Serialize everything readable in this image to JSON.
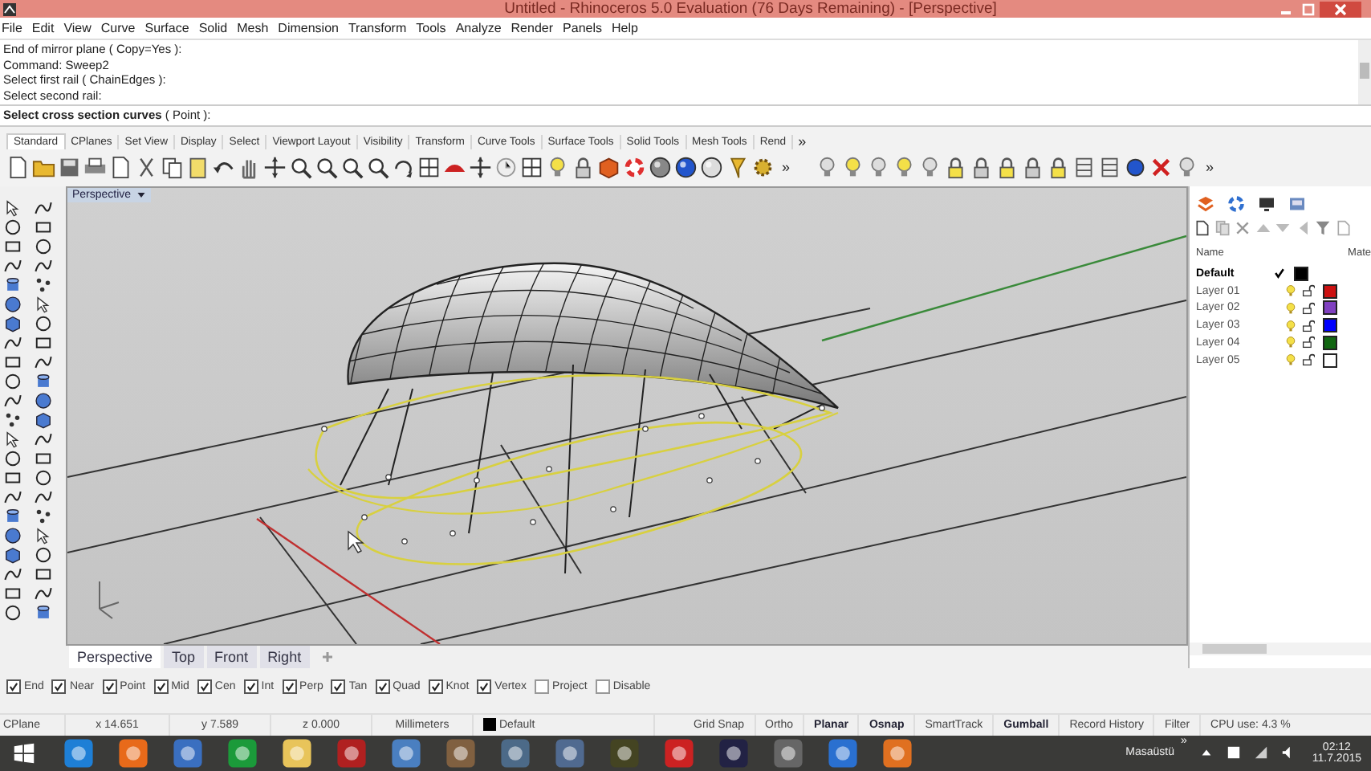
{
  "window": {
    "title": "Untitled - Rhinoceros 5.0 Evaluation (76 Days Remaining) - [Perspective]"
  },
  "menu": [
    "File",
    "Edit",
    "View",
    "Curve",
    "Surface",
    "Solid",
    "Mesh",
    "Dimension",
    "Transform",
    "Tools",
    "Analyze",
    "Render",
    "Panels",
    "Help"
  ],
  "command_history": [
    "End of mirror plane ( Copy=Yes ):",
    "Command: Sweep2",
    "Select first rail ( ChainEdges ):",
    "Select second rail:"
  ],
  "command_prompt": "**Select cross section curves** ( Point ):",
  "toolbar": {
    "tabs": [
      {
        "label": "Standard",
        "selected": true
      },
      {
        "label": "CPlanes",
        "selected": false
      },
      {
        "label": "Set View",
        "selected": false
      },
      {
        "label": "Display",
        "selected": false
      },
      {
        "label": "Select",
        "selected": false
      },
      {
        "label": "Viewport Layout",
        "selected": false
      },
      {
        "label": "Visibility",
        "selected": false
      },
      {
        "label": "Transform",
        "selected": false
      },
      {
        "label": "Curve Tools",
        "selected": false
      },
      {
        "label": "Surface Tools",
        "selected": false
      },
      {
        "label": "Solid Tools",
        "selected": false
      },
      {
        "label": "Mesh Tools",
        "selected": false
      },
      {
        "label": "Rend",
        "selected": false
      }
    ],
    "tabs_overflow": "»",
    "icons_overflow": "»",
    "right_overflow": "»"
  },
  "viewport": {
    "label": "Perspective"
  },
  "viewport_tabs": [
    {
      "label": "Perspective",
      "selected": true
    },
    {
      "label": "Top",
      "selected": false
    },
    {
      "label": "Front",
      "selected": false
    },
    {
      "label": "Right",
      "selected": false
    }
  ],
  "layers_panel": {
    "columns": [
      "Name",
      "Mate"
    ],
    "layers": [
      {
        "name": "Default",
        "current": true,
        "color": "#000000"
      },
      {
        "name": "Layer 01",
        "current": false,
        "color": "#cc1111"
      },
      {
        "name": "Layer 02",
        "current": false,
        "color": "#8040c0"
      },
      {
        "name": "Layer 03",
        "current": false,
        "color": "#0000ff"
      },
      {
        "name": "Layer 04",
        "current": false,
        "color": "#116611"
      },
      {
        "name": "Layer 05",
        "current": false,
        "color": "#ffffff"
      }
    ]
  },
  "osnaps": [
    {
      "label": "End",
      "checked": true
    },
    {
      "label": "Near",
      "checked": true
    },
    {
      "label": "Point",
      "checked": true
    },
    {
      "label": "Mid",
      "checked": true
    },
    {
      "label": "Cen",
      "checked": true
    },
    {
      "label": "Int",
      "checked": true
    },
    {
      "label": "Perp",
      "checked": true
    },
    {
      "label": "Tan",
      "checked": true
    },
    {
      "label": "Quad",
      "checked": true
    },
    {
      "label": "Knot",
      "checked": true
    },
    {
      "label": "Vertex",
      "checked": true
    },
    {
      "label": "Project",
      "checked": false
    },
    {
      "label": "Disable",
      "checked": false
    }
  ],
  "status_bar": {
    "cplane": "CPlane",
    "x": "x 14.651",
    "y": "y 7.589",
    "z": "z 0.000",
    "units": "Millimeters",
    "layer": {
      "name": "Default",
      "color": "#000000"
    },
    "toggles": [
      {
        "label": "Grid Snap",
        "on": false
      },
      {
        "label": "Ortho",
        "on": false
      },
      {
        "label": "Planar",
        "on": true
      },
      {
        "label": "Osnap",
        "on": true
      },
      {
        "label": "SmartTrack",
        "on": false
      },
      {
        "label": "Gumball",
        "on": true
      },
      {
        "label": "Record History",
        "on": false
      }
    ],
    "filter": "Filter",
    "cpu": "CPU use: 4.3 %"
  },
  "taskbar": {
    "desktop_label": "Masaüstü",
    "overflow": "»",
    "time": "02:12",
    "date": "11.7.2015"
  }
}
